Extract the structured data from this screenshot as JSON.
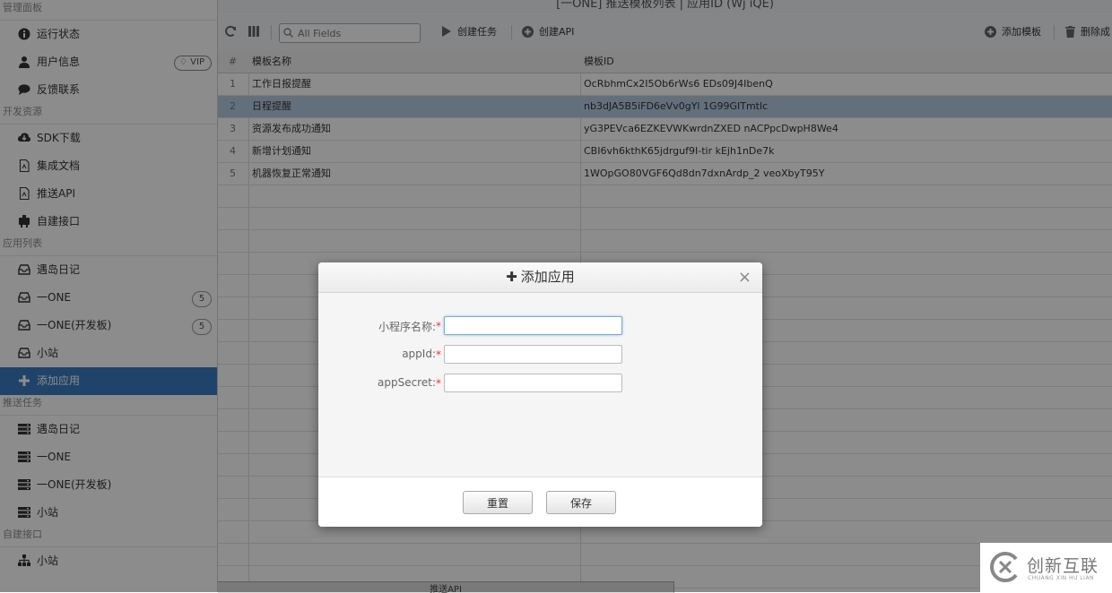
{
  "window": {
    "title": "[一ONE] 推送模板列表 | 应用ID (Wj        iQE)"
  },
  "sidebar": {
    "sections": [
      {
        "title": "管理面板",
        "items": [
          {
            "label": "运行状态",
            "icon": "info-icon"
          },
          {
            "label": "用户信息",
            "icon": "user-icon",
            "tag": "VIP"
          },
          {
            "label": "反馈联系",
            "icon": "comment-icon"
          }
        ]
      },
      {
        "title": "开发资源",
        "items": [
          {
            "label": "SDK下载",
            "icon": "cloud-download-icon"
          },
          {
            "label": "集成文档",
            "icon": "document-icon"
          },
          {
            "label": "推送API",
            "icon": "document-icon"
          },
          {
            "label": "自建接口",
            "icon": "plugin-icon"
          }
        ]
      },
      {
        "title": "应用列表",
        "items": [
          {
            "label": "遇岛日记",
            "icon": "inbox-icon"
          },
          {
            "label": "一ONE",
            "icon": "inbox-icon",
            "badge": "5"
          },
          {
            "label": "一ONE(开发板)",
            "icon": "inbox-icon",
            "badge": "5"
          },
          {
            "label": "小站",
            "icon": "inbox-icon"
          },
          {
            "label": "添加应用",
            "icon": "plus-icon",
            "active": true
          }
        ]
      },
      {
        "title": "推送任务",
        "items": [
          {
            "label": "遇岛日记",
            "icon": "server-icon"
          },
          {
            "label": "一ONE",
            "icon": "server-icon"
          },
          {
            "label": "一ONE(开发板)",
            "icon": "server-icon"
          },
          {
            "label": "小站",
            "icon": "server-icon"
          }
        ]
      },
      {
        "title": "自建接口",
        "items": [
          {
            "label": "小站",
            "icon": "sitemap-icon"
          }
        ]
      }
    ]
  },
  "toolbar": {
    "search_placeholder": "All Fields",
    "create_task": "创建任务",
    "create_api": "创建API",
    "add_template": "添加模板",
    "delete": "删除成"
  },
  "table": {
    "headers": [
      "#",
      "模板名称",
      "模板ID"
    ],
    "rows": [
      {
        "num": "1",
        "name": "工作日报提醒",
        "id": "OcRbhmCx2I5Ob6rWs6              EDs09J4IbenQ"
      },
      {
        "num": "2",
        "name": "日程提醒",
        "id": "nb3dJA5B5iFD6eVv0gYl              1G99GITmtlc",
        "selected": true
      },
      {
        "num": "3",
        "name": "资源发布成功通知",
        "id": "yG3PEVca6EZKEVWKwrdnZXED           nACPpcDwpH8We4"
      },
      {
        "num": "4",
        "name": "新增计划通知",
        "id": "CBI6vh6kthK65jdrguf9I-tir           kEjh1nDe7k"
      },
      {
        "num": "5",
        "name": "机器恢复正常通知",
        "id": "1WOpGO80VGF6Qd8dn7dxnArdp_2           veoXbyT95Y"
      }
    ]
  },
  "bottom_tab": "推送API",
  "dialog": {
    "title": "添加应用",
    "fields": [
      {
        "label": "小程序名称:",
        "value": ""
      },
      {
        "label": "appId:",
        "value": ""
      },
      {
        "label": "appSecret:",
        "value": ""
      }
    ],
    "required_mark": "*",
    "reset_label": "重置",
    "save_label": "保存",
    "close_symbol": "×"
  },
  "watermark": {
    "name": "创新互联",
    "pinyin": "CHUANG XIN HU LIAN"
  },
  "colors": {
    "accent": "#3a7bc0",
    "selected_row": "#b7cbe2",
    "required": "#ee3333"
  }
}
